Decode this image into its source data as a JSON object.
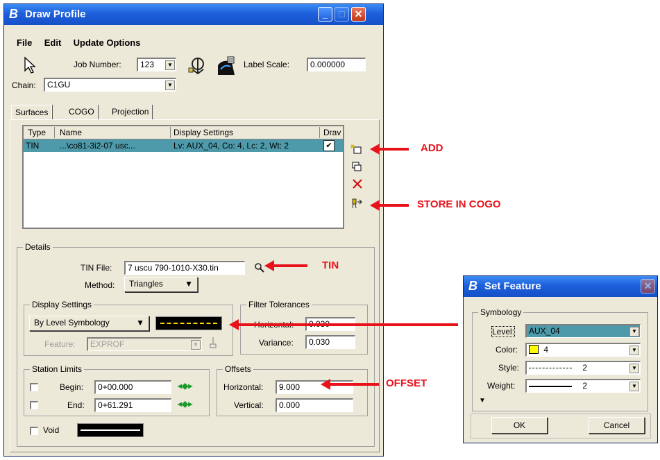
{
  "main_window": {
    "title": "Draw Profile",
    "logo_text": "B",
    "menu": [
      "File",
      "Edit",
      "Update Options"
    ],
    "job_number_label": "Job Number:",
    "job_number_value": "123",
    "label_scale_label": "Label Scale:",
    "label_scale_value": "0.000000",
    "chain_label": "Chain:",
    "chain_value": "C1GU",
    "tabs": [
      "Surfaces",
      "COGO",
      "Projection"
    ],
    "table": {
      "headers": [
        "Type",
        "Name",
        "Display Settings",
        "Drav"
      ],
      "rows": [
        {
          "type": "TIN",
          "name": "...\\co81-3i2-07 usc...",
          "display": "Lv: AUX_04, Co: 4, Lc: 2, Wt: 2",
          "checked": "✔"
        }
      ]
    },
    "details": {
      "group_label": "Details",
      "tin_file_label": "TIN File:",
      "tin_file_value": "7 uscu 790-1010-X30.tin",
      "method_label": "Method:",
      "method_value": "Triangles",
      "display_settings_label": "Display Settings",
      "symbology_value": "By Level Symbology",
      "feature_label": "Feature:",
      "feature_value": "EXPROF",
      "filter_label": "Filter Tolerances",
      "horizontal_label": "Horizontal:",
      "horizontal_value": "0.030",
      "variance_label": "Variance:",
      "variance_value": "0.030",
      "station_limits_label": "Station Limits",
      "begin_label": "Begin:",
      "begin_value": "0+00.000",
      "end_label": "End:",
      "end_value": "0+61.291",
      "offsets_label": "Offsets",
      "off_horizontal_label": "Horizontal:",
      "off_horizontal_value": "9.000",
      "off_vertical_label": "Vertical:",
      "off_vertical_value": "0.000",
      "void_label": "Void"
    }
  },
  "set_feature": {
    "title": "Set Feature",
    "logo_text": "B",
    "symbology_label": "Symbology",
    "level_label": "Level:",
    "level_value": "AUX_04",
    "color_label": "Color:",
    "color_value": "4",
    "style_label": "Style:",
    "style_value": "2",
    "weight_label": "Weight:",
    "weight_value": "2",
    "ok_label": "OK",
    "cancel_label": "Cancel"
  },
  "annotations": {
    "add": "ADD",
    "store": "STORE IN COGO",
    "tin": "TIN",
    "offset": "OFFSET"
  },
  "colors": {
    "title_blue": "#1e5fdc",
    "selection": "#4e9aaa",
    "annotation_red": "#e8121b",
    "color_swatch": "#ffff00"
  }
}
